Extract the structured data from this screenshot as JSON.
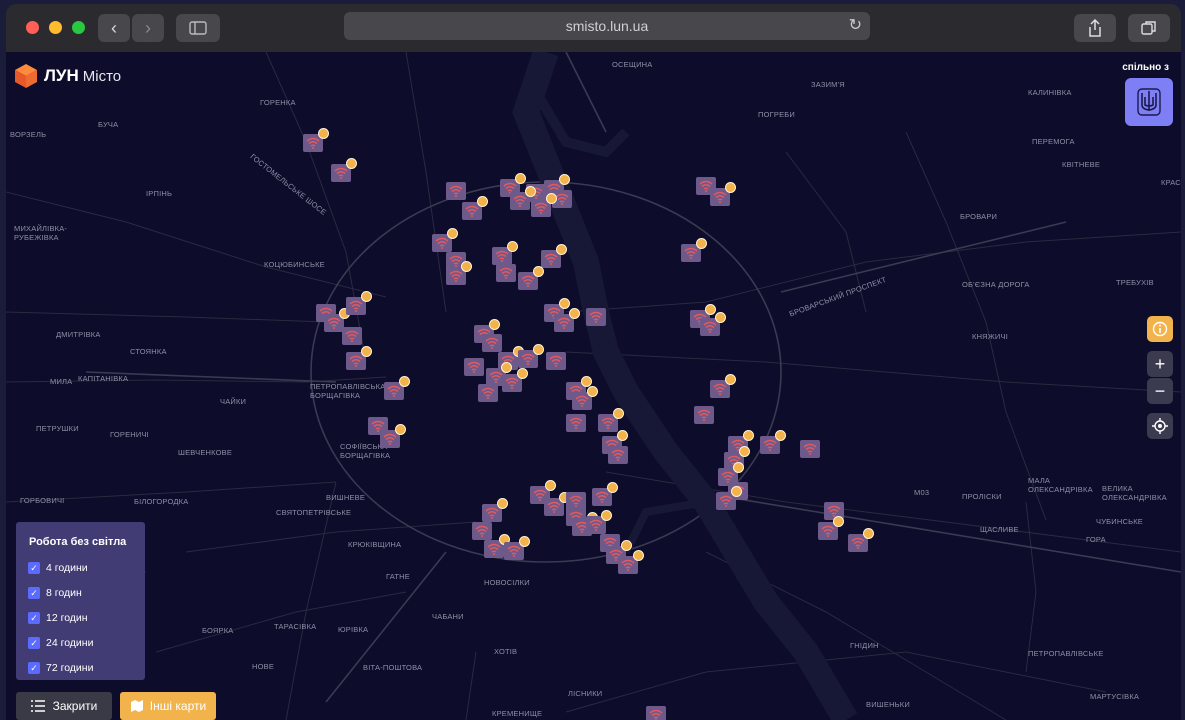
{
  "browser": {
    "url": "smisto.lun.ua",
    "back_icon": "chevron-left-icon",
    "forward_icon": "chevron-right-icon"
  },
  "app": {
    "logo_brand": "ЛУН",
    "logo_sub": "Місто",
    "spilno_label": "спільно з"
  },
  "colors": {
    "accent": "#f3b34c",
    "marker": "#6e5a8a",
    "map_bg": "#0d0c2a",
    "legend_bg": "#413d74"
  },
  "map": {
    "labels": [
      "ОСЕЩИНА",
      "ЗАЗИМ'Я",
      "ПОГРЕБИ",
      "КАЛИНІВКА",
      "ГОРЕНКА",
      "БУЧА",
      "ВОРЗЕЛЬ",
      "ПЕРЕМОГА",
      "КВІТНЕВЕ",
      "КРАСІ",
      "ГОСТОМЕЛЬСЬКЕ ШОСЕ",
      "ІРПІНЬ",
      "БРОВАРИ",
      "МИХАЙЛІВКА-РУБЕЖІВКА",
      "КОЦЮБИНСЬКЕ",
      "БРОВАРСЬКИЙ ПРОСПЕКТ",
      "ОБ'ЄЗНА ДОРОГА",
      "ТРЕБУХІВ",
      "ДМИТРІВКА",
      "КНЯЖИЧІ",
      "СТОЯНКА",
      "МИЛА",
      "КАПІТАНІВКА",
      "ПЕТРОПАВЛІВСЬКА БОРЩАГІВКА",
      "ЧАЙКИ",
      "ПЕТРУШКИ",
      "ГОРЕНИЧІ",
      "СОФІЇВСЬКА БОРЩАГІВКА",
      "ШЕВЧЕНКОВЕ",
      "МАЛА ОЛЕКСАНДРІВКА",
      "М03",
      "ПРОЛІСКИ",
      "ВЕЛИКА ОЛЕКСАНДРІВКА",
      "ГОРБОВИЧІ",
      "БІЛОГОРОДКА",
      "ВИШНЕВЕ",
      "СВЯТОПЕТРІВСЬКЕ",
      "ЧУБИНСЬКЕ",
      "ЩАСЛИВЕ",
      "ГОРА",
      "КРЮКІВЩИНА",
      "ГАТНЕ",
      "НОВОСІЛКИ",
      "БОЯРКА",
      "ТАРАСІВКА",
      "ЮРІВКА",
      "ЧАБАНИ",
      "ГНІДИН",
      "ХОТІВ",
      "НОВЕ",
      "ВІТА-ПОШТОВА",
      "ПЕТРОПАВЛІВСЬКЕ",
      "МАРТУСІВКА",
      "ЛІСНИКИ",
      "ВИШЕНЬКИ",
      "КРЕМЕНИЩЕ"
    ]
  },
  "legend": {
    "title": "Робота без світла",
    "items": [
      {
        "label": "4 години",
        "checked": true
      },
      {
        "label": "8 годин",
        "checked": true
      },
      {
        "label": "12 годин",
        "checked": true
      },
      {
        "label": "24 години",
        "checked": true
      },
      {
        "label": "72 години",
        "checked": true
      }
    ]
  },
  "buttons": {
    "close_label": "Закрити",
    "other_maps_label": "Інші карти"
  },
  "controls": {
    "zoom_in": "+",
    "zoom_out": "−"
  }
}
